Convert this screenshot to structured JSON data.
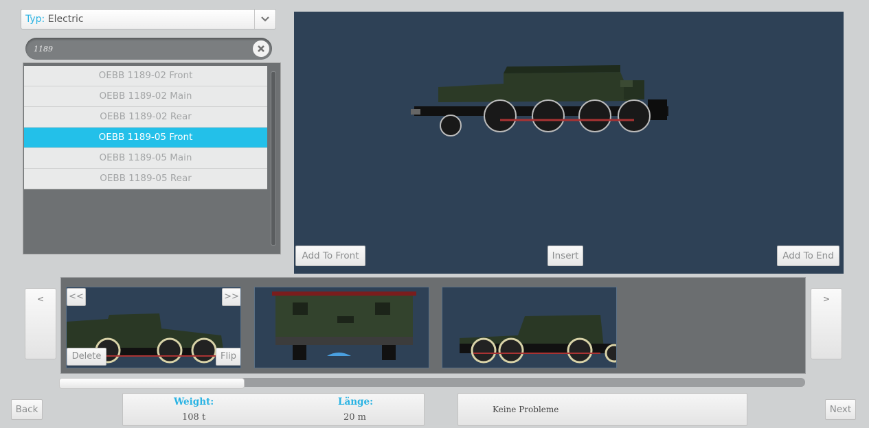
{
  "type_filter": {
    "label": "Typ:",
    "value": "Electric"
  },
  "search": {
    "value": "1189"
  },
  "vehicle_list": {
    "items": [
      {
        "label": "OEBB 1189-02 Front",
        "selected": false
      },
      {
        "label": "OEBB 1189-02 Main",
        "selected": false
      },
      {
        "label": "OEBB 1189-02 Rear",
        "selected": false
      },
      {
        "label": "OEBB 1189-05 Front",
        "selected": true
      },
      {
        "label": "OEBB 1189-05 Main",
        "selected": false
      },
      {
        "label": "OEBB 1189-05 Rear",
        "selected": false
      }
    ]
  },
  "preview": {
    "add_front_label": "Add To Front",
    "insert_label": "Insert",
    "add_end_label": "Add To End"
  },
  "consist": {
    "prev_label": "<",
    "next_label": ">",
    "move_left_label": "<<",
    "move_right_label": ">>",
    "delete_label": "Delete",
    "flip_label": "Flip"
  },
  "footer": {
    "back_label": "Back",
    "next_label": "Next",
    "weight_label": "Weight:",
    "weight_value": "108 t",
    "length_label": "Länge:",
    "length_value": "20 m",
    "status_text": "Keine Probleme"
  },
  "colors": {
    "accent": "#23c0e9",
    "preview_bg": "#2e4156"
  }
}
